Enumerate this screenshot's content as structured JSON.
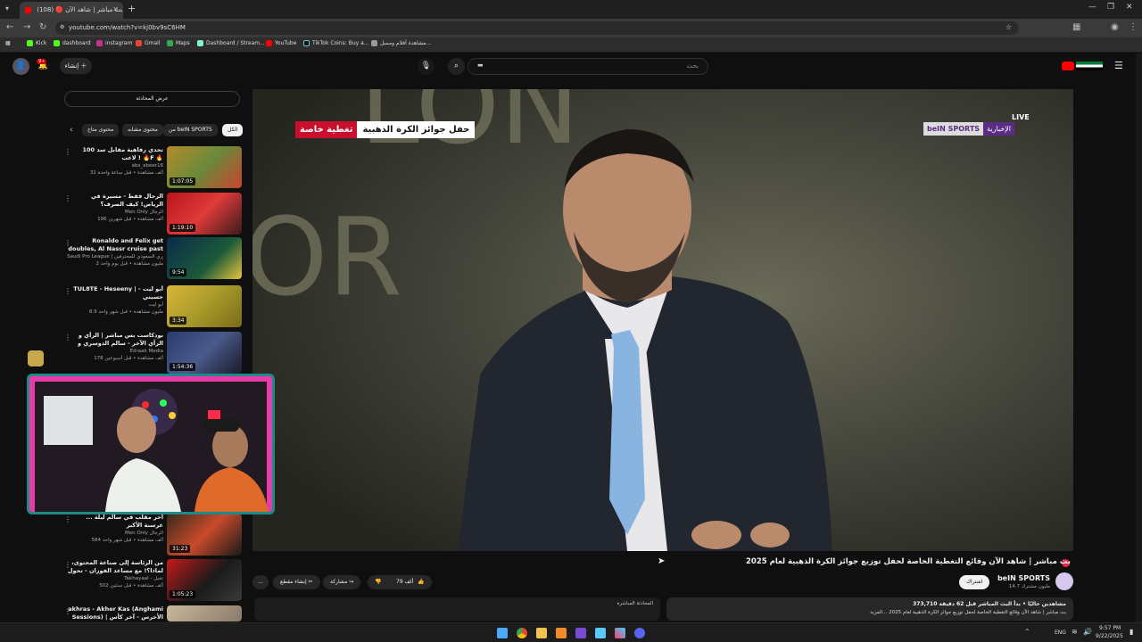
{
  "browser": {
    "tab_title": "(108) 🔴 بث مباشر | شاهد الآن",
    "url": "youtube.com/watch?v=kj0bv9sC6HM",
    "bookmarks": [
      "Kick",
      "dashboard",
      "instagram",
      "Gmail",
      "Maps",
      "Dashboard / Stream...",
      "YouTube",
      "TikTok Coins: Buy a...",
      "مشاهدة أفلام ومسل..."
    ]
  },
  "header": {
    "create_label": "إنشاء",
    "notif_count": "9+",
    "search_placeholder": "بحث"
  },
  "sidebar": {
    "chat_button": "عرض المحادثة",
    "chips": [
      "الكل",
      "من beIN SPORTS",
      "محتوى مشابه",
      "محتوى متاح"
    ],
    "videos": [
      {
        "title": "تحدي رفاهية مقابل سد 100 لاعب ! 🔥F 🔥",
        "channel": "abs_abeer16",
        "stats": "32 ألف مشاهدة • قبل ساعة واحدة",
        "duration": "1:07:05"
      },
      {
        "title": "الرجال فقط - مسيرة في الرياض! كيف الصرف؟",
        "channel": "Men Only الرجال",
        "stats": "196 ألف مشاهدة • قبل شهرين",
        "duration": "1:19:10"
      },
      {
        "title": "Ronaldo and Felix get doubles, Al Nassr cruise past Al Riyadh!...",
        "channel": "Saudi Pro League | الدوري السعودي للمحترفين",
        "stats": "2 مليون مشاهدة • قبل يوم واحد",
        "duration": "9:54"
      },
      {
        "title": "TUL8TE - Heseeny | أبو ليت - حسيني",
        "channel": "أبو ليت",
        "stats": "8.9 مليون مشاهدة • قبل شهر واحد",
        "duration": "3:34"
      },
      {
        "title": "بودكاست بس مباشر | الرأي و الرأي الآخر - سالم الدوسري و جائل ابو مرين",
        "channel": "Edraak Media",
        "stats": "178 ألف مشاهدة • قبل أسبوعين",
        "duration": "1:54:36"
      },
      {
        "title": "... آخر مقلب في سالم ليلة عرسنة الأكبر",
        "channel": "Men Only الرجال",
        "stats": "584 ألف مشاهدة • قبل شهر واحد",
        "duration": "31:23"
      },
      {
        "title": "من الرئاسة إلى صناعة المحتوى، لماذا؟! مع مساعد الفوزان - تحول بودكاست",
        "channel": "Takhayaal - تخيل",
        "stats": "502 ألف مشاهدة • قبل سنتين",
        "duration": "1:05:23"
      },
      {
        "title": "akhras - Akher Kas (Anghami Sessions) | الأخرس - آخر كأس",
        "channel": "",
        "stats": "",
        "duration": ""
      }
    ]
  },
  "player": {
    "lower_third_title": "حفل جوائز الكرة الذهبية",
    "lower_third_tag": "تغطية خاصة",
    "live_label": "LIVE",
    "channel_bug": "beIN SPORTS",
    "channel_bug_sub": "الإخبارية",
    "background_letters": "LON OR"
  },
  "video": {
    "title": "بث مباشر | شاهد الآن وقائع التغطية الخاصة لحفل توزيع جوائز الكرة الذهبية لعام 2025",
    "channel": "beIN SPORTS",
    "subscribers": "14.7 مليون مشترك",
    "join_label": "اشتراك",
    "likes": "79 ألف",
    "share_label": "مشاركة",
    "clip_label": "إنشاء مقطع",
    "more_label": "...",
    "viewers": "373,710 مشاهدين حاليًا • بدأ البث المباشر قبل 62 دقيقة",
    "desc_line": "بث مباشر | شاهد الآن وقائع التغطية الخاصة لحفل توزيع جوائز الكرة الذهبية لعام 2025 ...المزيد",
    "live_chat_label": "المحادثة المباشرة"
  },
  "taskbar": {
    "lang": "ENG",
    "time": "9:57 PM",
    "date": "9/22/2025"
  },
  "colors": {
    "bg": "#0f0f0f",
    "accent_red": "#ff0000",
    "lower_third_red": "#c8102e",
    "bein_purple": "#5b2c83"
  }
}
